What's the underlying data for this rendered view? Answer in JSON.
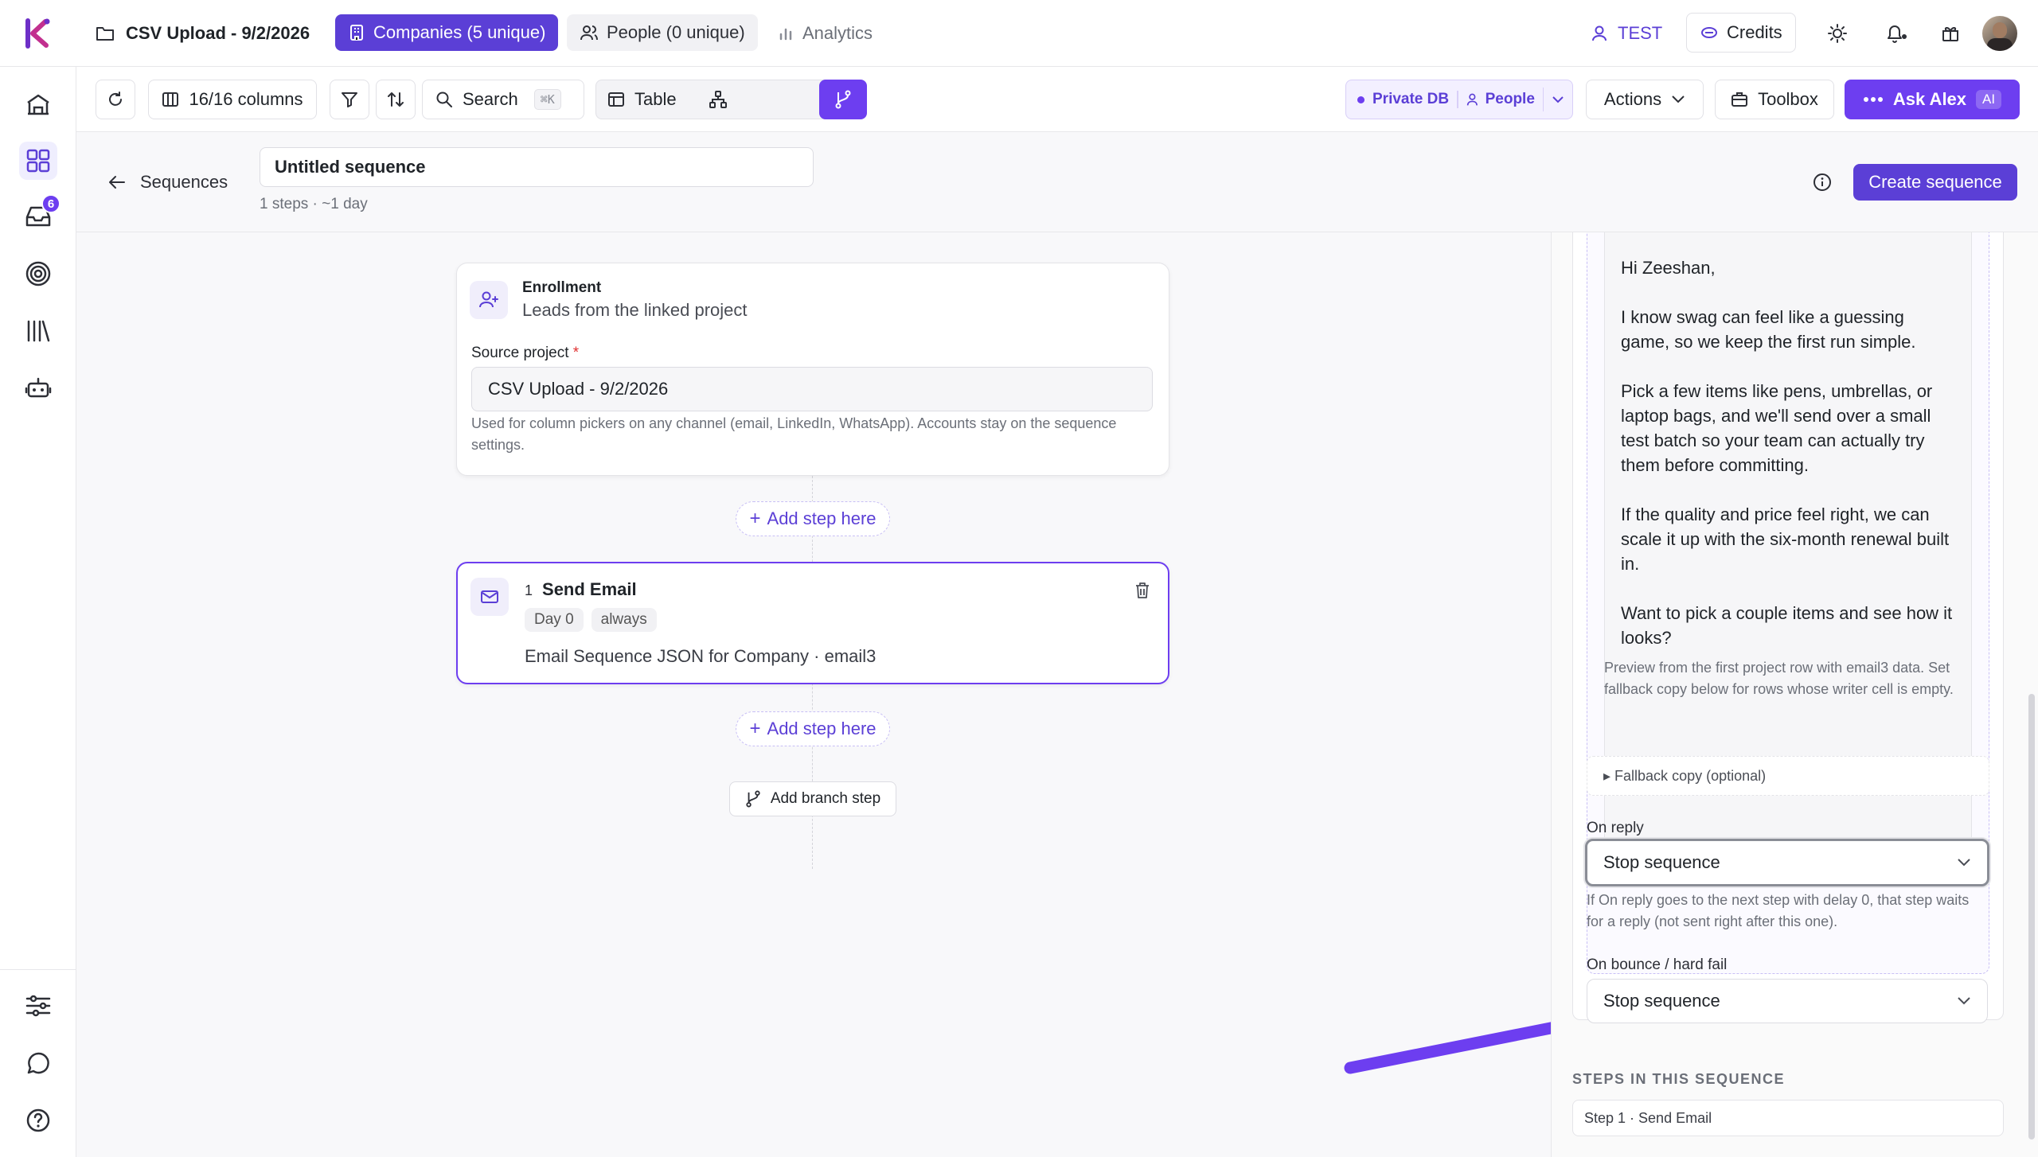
{
  "top": {
    "project_title": "CSV Upload - 9/2/2026",
    "tabs": [
      {
        "label": "Companies (5 unique)"
      },
      {
        "label": "People (0 unique)"
      },
      {
        "label": "Analytics"
      }
    ],
    "test_label": "TEST",
    "credits_label": "Credits",
    "badge_count": "6"
  },
  "toolbar": {
    "columns_label": "16/16 columns",
    "search_label": "Search",
    "search_shortcut": "⌘K",
    "table_label": "Table",
    "db_label": "Private DB",
    "people_label": "People",
    "actions_label": "Actions",
    "toolbox_label": "Toolbox",
    "ask_label": "Ask Alex",
    "ai_label": "AI"
  },
  "sequence": {
    "back_label": "Sequences",
    "name_value": "Untitled sequence",
    "meta": "1 steps · ~1 day",
    "create_label": "Create sequence"
  },
  "enrollment": {
    "title": "Enrollment",
    "subtitle": "Leads from the linked project",
    "source_label": "Source project",
    "required_mark": "*",
    "source_value": "CSV Upload - 9/2/2026",
    "help": "Used for column pickers on any channel (email, LinkedIn, WhatsApp). Accounts stay on the sequence settings."
  },
  "add_step_label": "Add step here",
  "step": {
    "number": "1",
    "title": "Send Email",
    "day_chip": "Day 0",
    "cond_chip": "always",
    "desc": "Email Sequence JSON for Company · email3"
  },
  "branch_label": "Add branch step",
  "panel": {
    "email_lines": [
      "Hi Zeeshan,",
      "I know swag can feel like a guessing game, so we keep the first run simple.",
      "Pick a few items like pens, umbrellas, or laptop bags, and we'll send over a small test batch so your team can actually try them before committing.",
      "If the quality and price feel right, we can scale it up with the six-month renewal built in.",
      "Want to pick a couple items and see how it looks?"
    ],
    "preview_note": "Preview from the first project row with email3 data. Set fallback copy below for rows whose writer cell is empty.",
    "fallback_label": "▸ Fallback copy (optional)",
    "on_reply_label": "On reply",
    "on_reply_value": "Stop sequence",
    "on_reply_help": "If On reply goes to the next step with delay 0, that step waits for a reply (not sent right after this one).",
    "bounce_label": "On bounce / hard fail",
    "bounce_value": "Stop sequence",
    "steps_heading": "STEPS IN THIS SEQUENCE",
    "steps_item": "Step 1 · Send Email"
  },
  "colors": {
    "accent": "#5b3fd6",
    "accent_light": "#efeefe",
    "arrow": "#6d3ef0"
  }
}
